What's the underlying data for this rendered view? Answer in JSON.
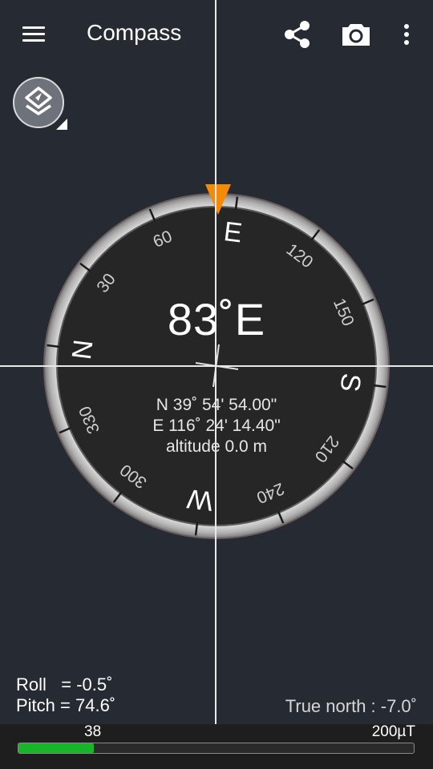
{
  "appbar": {
    "title": "Compass",
    "icons": [
      "hamburger-menu-icon",
      "share-icon",
      "camera-icon",
      "more-vert-icon"
    ]
  },
  "layers_button": {
    "icon": "layers-compass-icon"
  },
  "compass": {
    "heading_text": "83˚E",
    "heading_degrees": 83,
    "cardinals": [
      {
        "label": "N",
        "deg": 0
      },
      {
        "label": "E",
        "deg": 90
      },
      {
        "label": "S",
        "deg": 180
      },
      {
        "label": "W",
        "deg": 270
      }
    ],
    "degree_labels": [
      {
        "label": "30",
        "deg": 30
      },
      {
        "label": "60",
        "deg": 60
      },
      {
        "label": "120",
        "deg": 120
      },
      {
        "label": "150",
        "deg": 150
      },
      {
        "label": "210",
        "deg": 210
      },
      {
        "label": "240",
        "deg": 240
      },
      {
        "label": "300",
        "deg": 300
      },
      {
        "label": "330",
        "deg": 330
      }
    ],
    "latitude": "N 39˚ 54' 54.00\"",
    "longitude": "E 116˚ 24' 14.40\"",
    "altitude": "altitude 0.0 m",
    "colors": {
      "pointer": "#f58a07",
      "dial": "#262626",
      "ring": "#bdbdbd"
    }
  },
  "sensors": {
    "roll": "Roll   = -0.5˚",
    "pitch": "Pitch = 74.6˚",
    "true_north": "True north : -7.0˚"
  },
  "magnetic": {
    "value_label": "38",
    "max_label": "200µT",
    "value": 38,
    "max": 200,
    "bar_color": "#18b52c"
  }
}
